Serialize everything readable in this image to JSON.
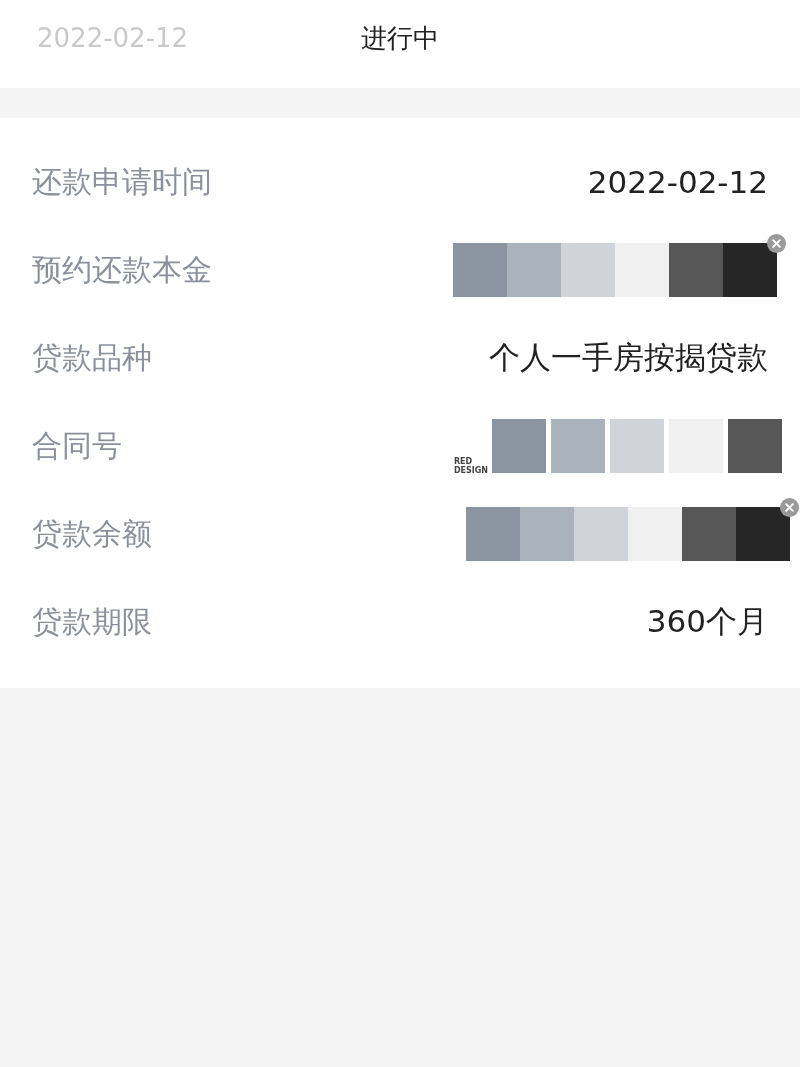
{
  "steps": [
    {
      "subtitle": "2022-02-12",
      "selected": false
    },
    {
      "subtitle": "进行中",
      "selected": true
    }
  ],
  "details": [
    {
      "label": "还款申请时间",
      "kind": "text",
      "value": "2022-02-12"
    },
    {
      "label": "预约还款本金",
      "kind": "palette",
      "close": true,
      "swatches": [
        {
          "color": "#8a95a1"
        },
        {
          "color": "#aab2bc"
        },
        {
          "color": "#d0d3da"
        },
        {
          "color": "#f0f0f0"
        },
        {
          "color": "#575757"
        },
        {
          "color": "#262626"
        }
      ]
    },
    {
      "label": "贷款品种",
      "kind": "text",
      "value": "个人一手房按揭贷款"
    },
    {
      "label": "合同号",
      "kind": "palette",
      "close": false,
      "logo": [
        "RED",
        "DESIGN"
      ],
      "swatches": [
        {
          "color": "#8a95a1"
        },
        {
          "color": "#aab2bc"
        },
        {
          "color": "#d0d3da"
        },
        {
          "color": "#f0f0f0"
        },
        {
          "color": "#575757"
        }
      ]
    },
    {
      "label": "贷款余额",
      "kind": "palette",
      "close": true,
      "swatches": [
        {
          "color": "#8a95a1"
        },
        {
          "color": "#aab2bc"
        },
        {
          "color": "#d0d3da"
        },
        {
          "color": "#f0f0f0"
        },
        {
          "color": "#575757"
        },
        {
          "color": "#262626"
        }
      ]
    },
    {
      "label": "贷款期限",
      "kind": "text",
      "value": "360个月"
    }
  ]
}
